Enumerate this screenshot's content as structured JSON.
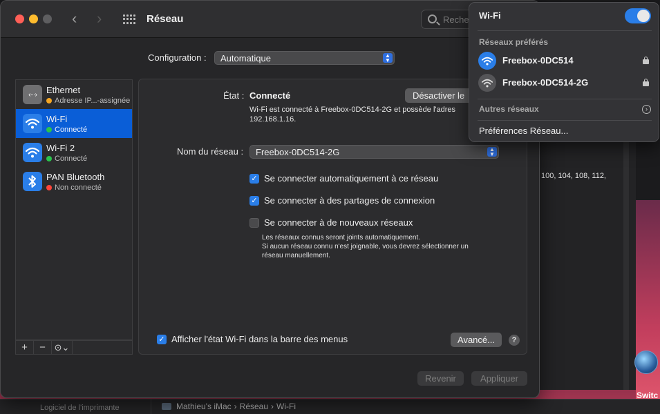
{
  "window": {
    "title": "Réseau",
    "search_placeholder": "Recher"
  },
  "configuration": {
    "label": "Configuration :",
    "value": "Automatique"
  },
  "services": [
    {
      "name": "Ethernet",
      "status": "Adresse IP...-assignée",
      "status_color": "#f5a623",
      "icon": "ethernet-icon"
    },
    {
      "name": "Wi-Fi",
      "status": "Connecté",
      "status_color": "#2ac34c",
      "icon": "wifi-icon",
      "selected": true
    },
    {
      "name": "Wi-Fi 2",
      "status": "Connecté",
      "status_color": "#2ac34c",
      "icon": "wifi-icon"
    },
    {
      "name": "PAN Bluetooth",
      "status": "Non connecté",
      "status_color": "#ff453a",
      "icon": "bluetooth-icon"
    }
  ],
  "sidebar_tools": {
    "add": "+",
    "remove": "−",
    "action": "⊙⌄"
  },
  "detail": {
    "etat_label": "État :",
    "etat_value": "Connecté",
    "deactivate_label": "Désactiver le",
    "status_description": "Wi-Fi est connecté à Freebox-0DC514-2G et possède l'adres",
    "status_ip": "192.168.1.16.",
    "network_name_label": "Nom du réseau :",
    "network_name_value": "Freebox-0DC514-2G",
    "options": [
      {
        "label": "Se connecter automatiquement à ce réseau",
        "checked": true
      },
      {
        "label": "Se connecter à des partages de connexion",
        "checked": true
      },
      {
        "label": "Se connecter à de nouveaux réseaux",
        "checked": false
      }
    ],
    "hint_lines": [
      "Les réseaux connus seront joints automatiquement.",
      "Si aucun réseau connu n'est joignable, vous devrez sélectionner un",
      "réseau manuellement."
    ],
    "show_wifi_status": {
      "label": "Afficher l'état Wi-Fi dans la barre des menus",
      "checked": true
    },
    "advanced_label": "Avancé...",
    "help_label": "?",
    "revert_label": "Revenir",
    "apply_label": "Appliquer"
  },
  "wifi_menu": {
    "title": "Wi-Fi",
    "toggle_on": true,
    "preferred_label": "Réseaux préférés",
    "networks": [
      {
        "name": "Freebox-0DC514",
        "active": true
      },
      {
        "name": "Freebox-0DC514-2G",
        "active": false
      }
    ],
    "other_label": "Autres réseaux",
    "prefs_label": "Préférences Réseau..."
  },
  "background": {
    "channel_text": "100, 104, 108, 112,",
    "switch_label": "Switc",
    "printer_label": "Logiciel de l'imprimante",
    "path": [
      "Mathieu's iMac",
      "Réseau",
      "Wi-Fi"
    ],
    "path_separator": "›"
  },
  "colors": {
    "accent": "#0a5ed7",
    "blue": "#2a7ee8"
  }
}
